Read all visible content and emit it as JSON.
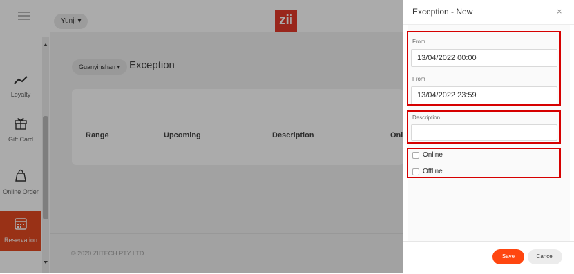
{
  "header": {
    "tenant": "Yunji ▾",
    "logo_text": "zii"
  },
  "sidebar": {
    "items": [
      {
        "label": "Loyalty",
        "icon": "trend-line-icon"
      },
      {
        "label": "Gift Card",
        "icon": "gift-icon"
      },
      {
        "label": "Online Order",
        "icon": "shopping-bag-icon"
      },
      {
        "label": "Reservation",
        "icon": "calendar-icon",
        "active": true
      }
    ]
  },
  "main": {
    "shop": "Guanyinshan ▾",
    "title": "Exception",
    "columns": [
      "Range",
      "Upcoming",
      "Description",
      "Onli"
    ],
    "copyright": "© 2020 ZIITECH PTY LTD"
  },
  "panel": {
    "title": "Exception - New",
    "close": "×",
    "from_label_1": "From",
    "from_value_1": "13/04/2022 00:00",
    "from_label_2": "From",
    "from_value_2": "13/04/2022 23:59",
    "description_label": "Description",
    "description_value": "",
    "online_label": "Online",
    "offline_label": "Offline",
    "save": "Save",
    "cancel": "Cancel"
  },
  "colors": {
    "brand": "#e53a2a",
    "accent": "#ff4610",
    "highlight": "#d60000"
  }
}
